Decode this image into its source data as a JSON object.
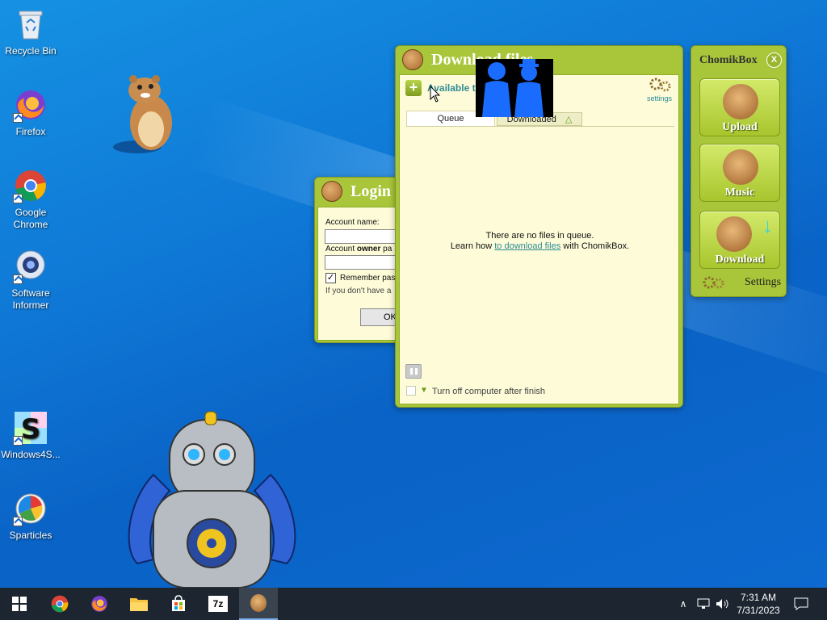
{
  "desktop": {
    "icons": [
      {
        "label": "Recycle Bin"
      },
      {
        "label": "Firefox"
      },
      {
        "label": "Google Chrome"
      },
      {
        "label": "Software Informer"
      },
      {
        "label": "Windows4S..."
      },
      {
        "label": "Sparticles"
      }
    ]
  },
  "login_window": {
    "title": "Login",
    "account_name_label": "Account name:",
    "account_owner_prefix": "Account ",
    "account_owner_bold": "owner",
    "account_owner_suffix": " pa",
    "remember_label": "Remember pass",
    "remember_checked": true,
    "hint_text": "If you don't have a",
    "ok_label": "OK"
  },
  "download_window": {
    "title": "Download files",
    "available_label": "Available t",
    "settings_label": "settings",
    "tabs": [
      {
        "label": "Queue"
      },
      {
        "label": "Downloaded"
      }
    ],
    "empty_line1": "There are no files in queue.",
    "empty_line2_prefix": "Learn how ",
    "empty_link": "to download files",
    "empty_line2_suffix": " with ChomikBox.",
    "turn_off_label": "Turn off computer after finish"
  },
  "side_panel": {
    "title": "ChomikBox",
    "close_label": "X",
    "buttons": [
      {
        "label": "Upload"
      },
      {
        "label": "Music"
      },
      {
        "label": "Download"
      }
    ],
    "settings_label": "Settings"
  },
  "taskbar": {
    "time": "7:31 AM",
    "date": "7/31/2023",
    "sevenzip_label": "7z"
  },
  "colors": {
    "window_green": "#a9c63a",
    "client_cream": "#fdfbd8",
    "link_teal": "#2e8c96",
    "taskbar": "#1c2530"
  }
}
